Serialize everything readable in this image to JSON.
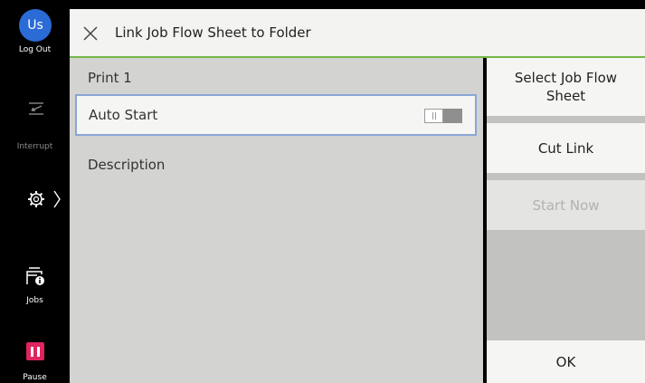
{
  "sidebar": {
    "avatar_initials": "Us",
    "logout_label": "Log Out",
    "interrupt_label": "Interrupt",
    "jobs_label": "Jobs",
    "pause_label": "Pause",
    "icons": [
      "interrupt-icon",
      "gear-icon",
      "chevron-right-icon",
      "jobs-info-icon",
      "pause-icon"
    ]
  },
  "header": {
    "title": "Link Job Flow Sheet to Folder",
    "accent_color": "#72b84a"
  },
  "panel": {
    "rows": [
      {
        "label": "Print 1"
      },
      {
        "label": "Auto Start",
        "toggle": "off"
      },
      {
        "label": "Description"
      }
    ]
  },
  "actions": {
    "select_job_flow": "Select Job Flow Sheet",
    "cut_link": "Cut Link",
    "start_now": "Start Now",
    "ok": "OK"
  },
  "colors": {
    "pause": "#e0245e",
    "avatar": "#2b6bd6",
    "focus_border": "#8aa6d6"
  }
}
